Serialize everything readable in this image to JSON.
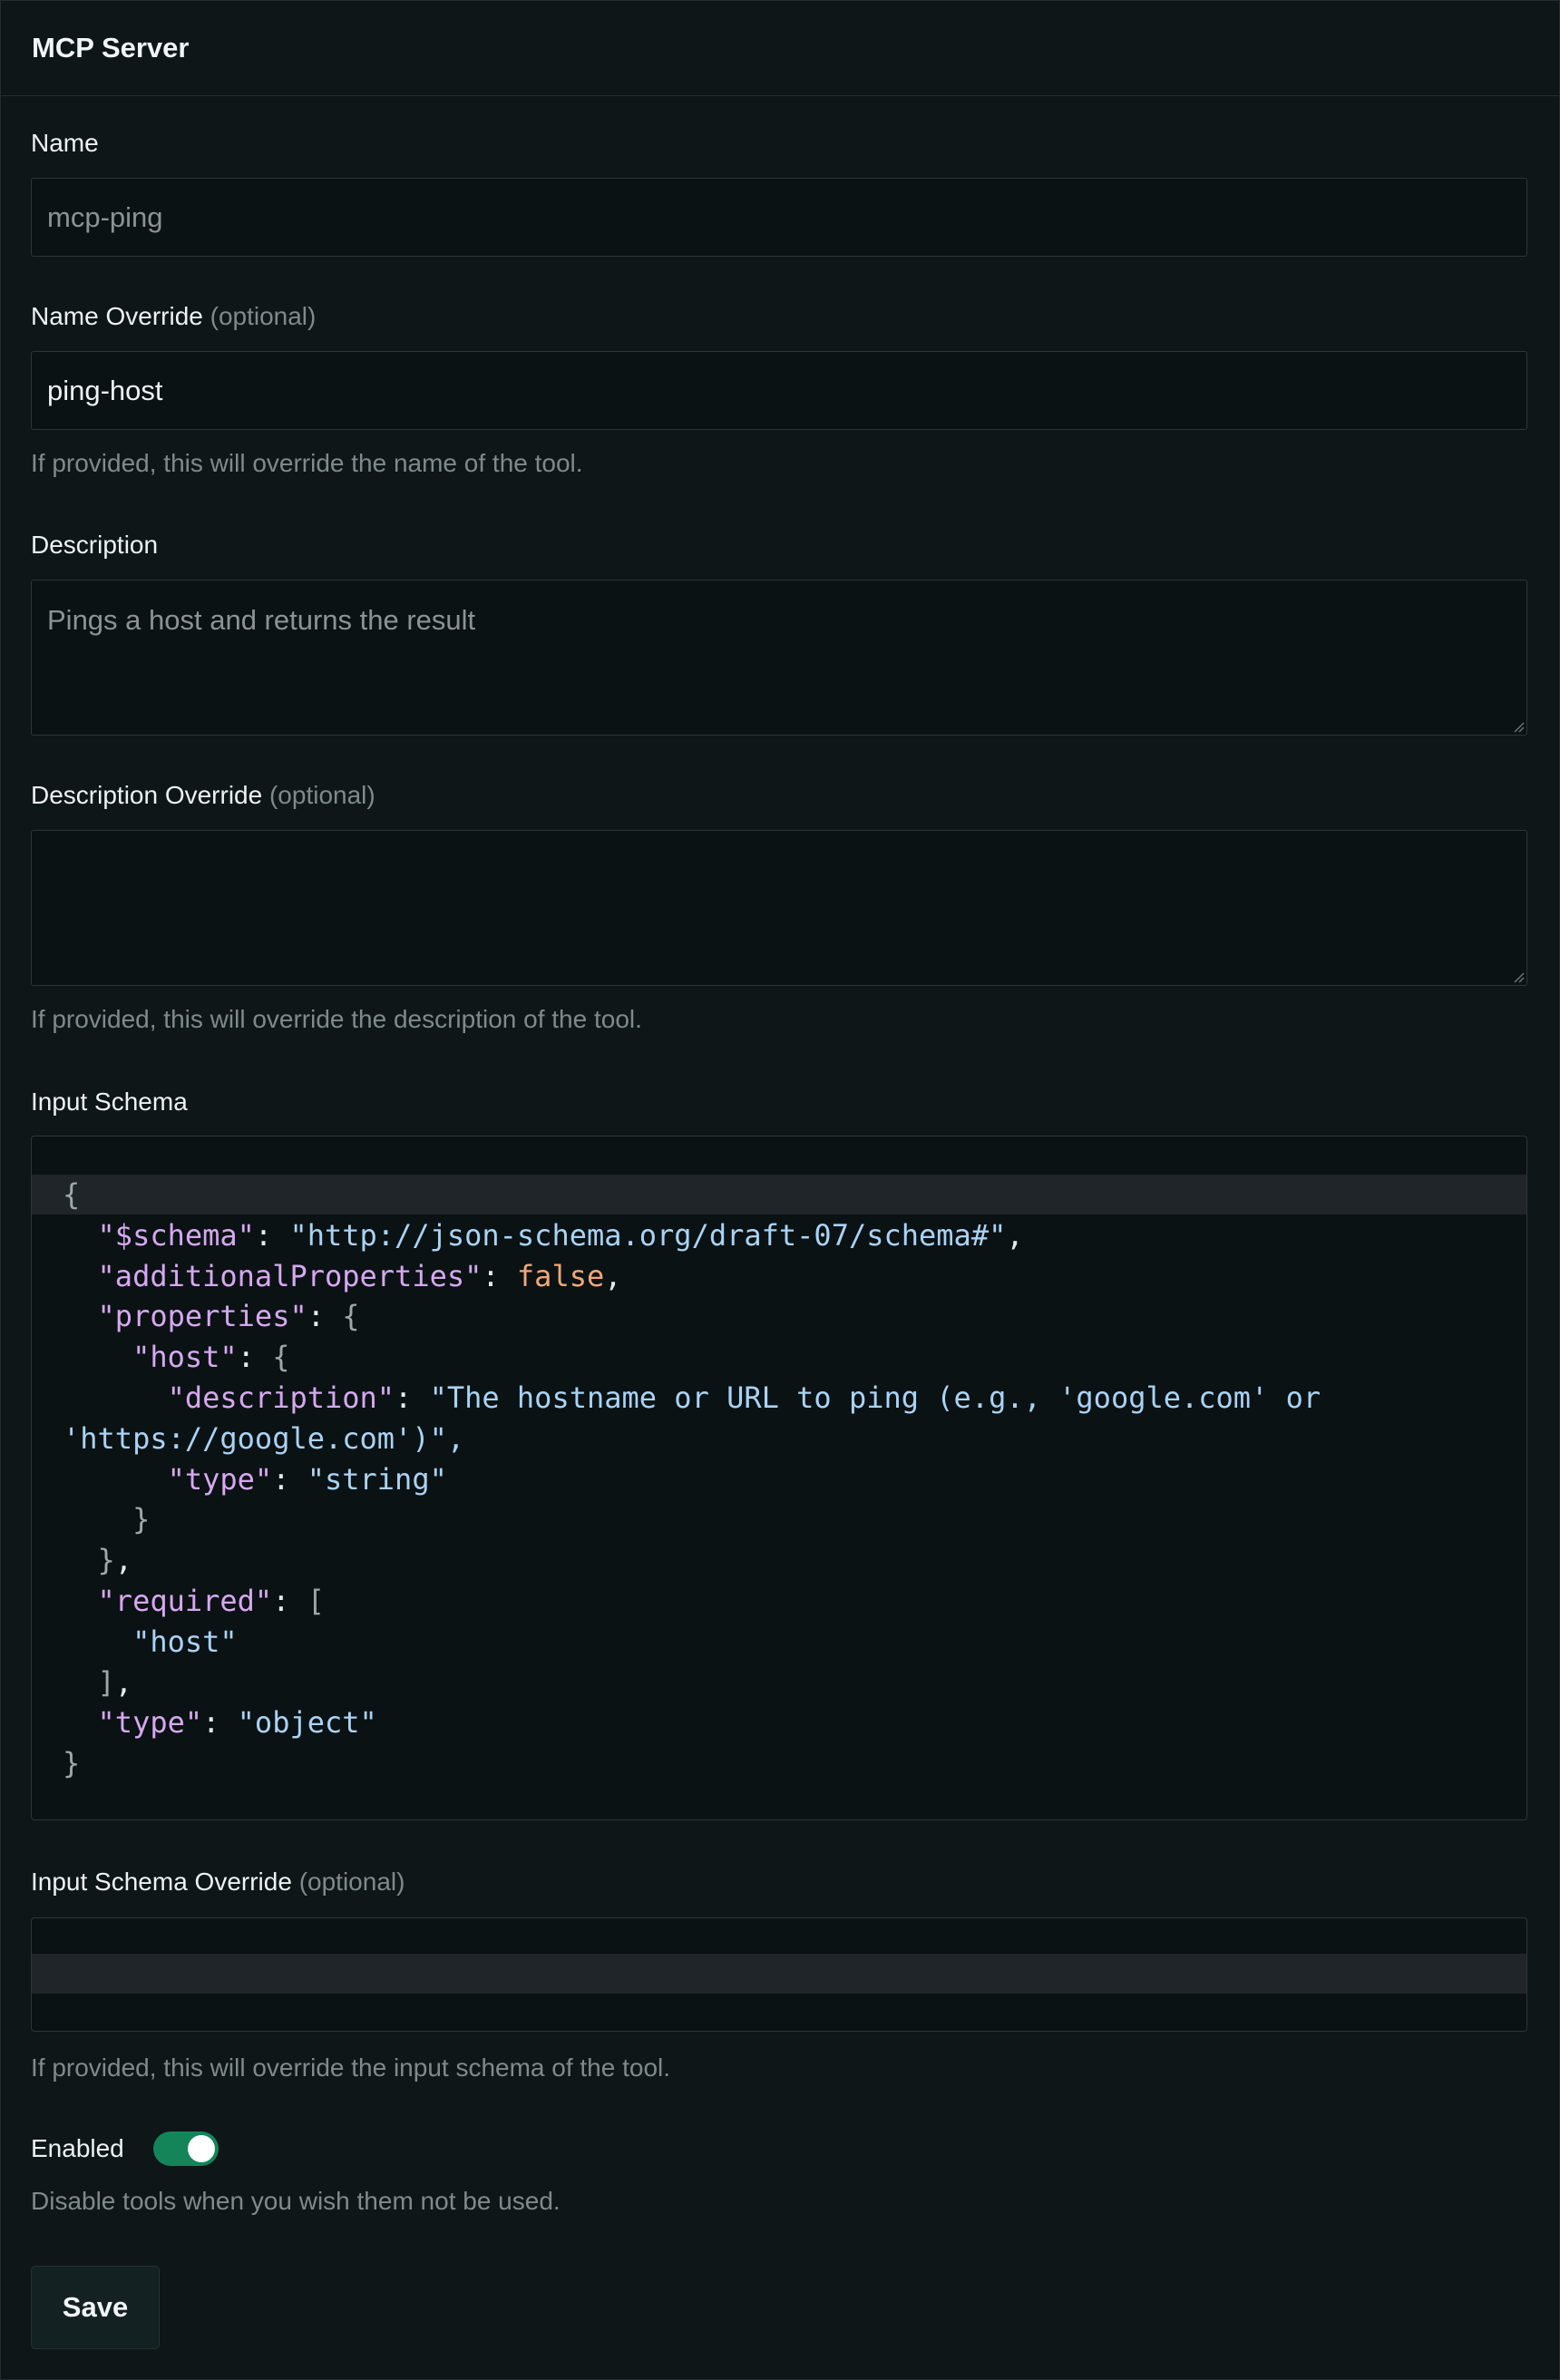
{
  "header": {
    "title": "MCP Server"
  },
  "name": {
    "label": "Name",
    "value": "mcp-ping"
  },
  "name_override": {
    "label": "Name Override",
    "optional": "(optional)",
    "value": "ping-host",
    "help": "If provided, this will override the name of the tool."
  },
  "description": {
    "label": "Description",
    "value": "Pings a host and returns the result"
  },
  "description_override": {
    "label": "Description Override",
    "optional": "(optional)",
    "value": "",
    "help": "If provided, this will override the description of the tool."
  },
  "input_schema": {
    "label": "Input Schema",
    "lines": [
      "{",
      "  \"$schema\": \"http://json-schema.org/draft-07/schema#\",",
      "  \"additionalProperties\": false,",
      "  \"properties\": {",
      "    \"host\": {",
      "      \"description\": \"The hostname or URL to ping (e.g., 'google.com' or",
      "'https://google.com')\",",
      "      \"type\": \"string\"",
      "    }",
      "  },",
      "  \"required\": [",
      "    \"host\"",
      "  ],",
      "  \"type\": \"object\"",
      "}"
    ]
  },
  "input_schema_override": {
    "label": "Input Schema Override",
    "optional": "(optional)",
    "value": "",
    "help": "If provided, this will override the input schema of the tool."
  },
  "enabled": {
    "label": "Enabled",
    "on": true,
    "help": "Disable tools when you wish them not be used."
  },
  "save": {
    "label": "Save"
  },
  "colors": {
    "background": "#0e1618",
    "toggle_on": "#138559",
    "json_key": "#d6a8f0",
    "json_string": "#a9d3f5",
    "json_bool": "#f0a878"
  }
}
